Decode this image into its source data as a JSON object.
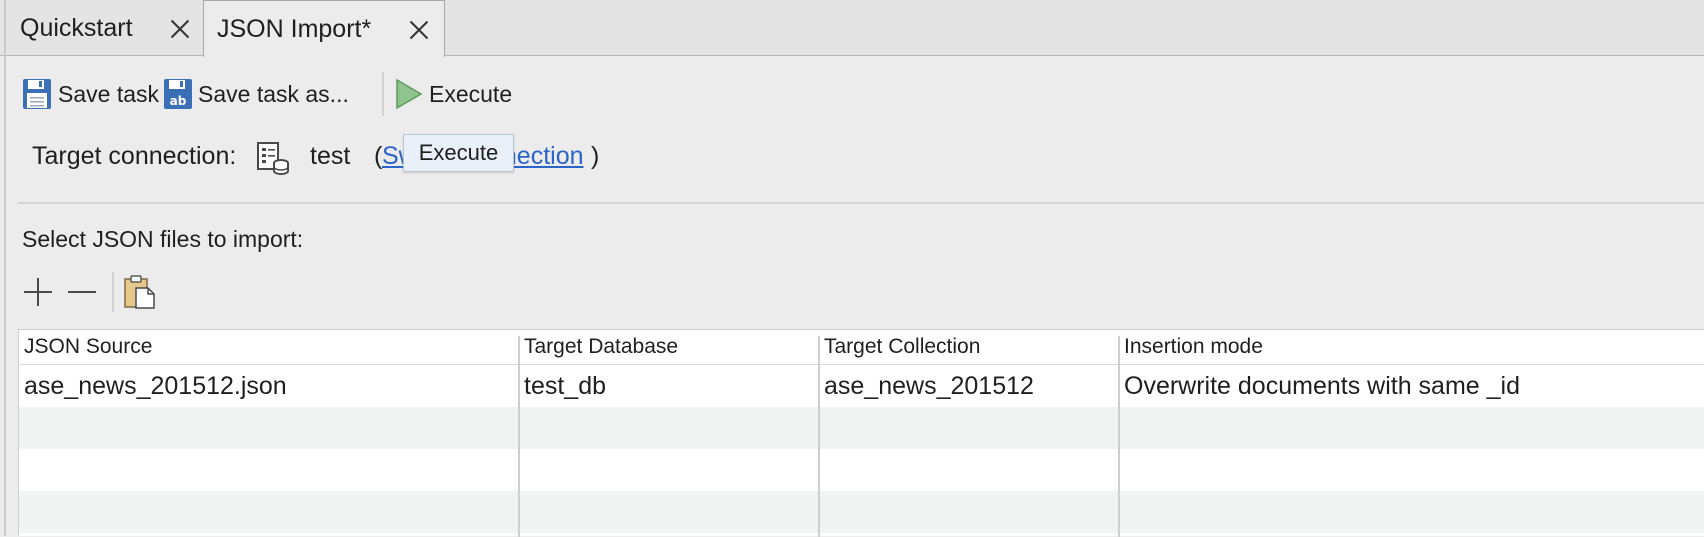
{
  "tabs": [
    {
      "label": "Quickstart"
    },
    {
      "label": "JSON Import*"
    }
  ],
  "toolbar": {
    "save_task": "Save task",
    "save_task_as": "Save task as...",
    "execute": "Execute"
  },
  "tooltip": {
    "text": "Execute"
  },
  "target": {
    "label": "Target connection:",
    "connection_name": "test",
    "open_paren": "(",
    "switch_link": "Switch connection",
    "close_paren": ")"
  },
  "import_section": {
    "label": "Select JSON files to import:"
  },
  "table": {
    "columns": [
      "JSON Source",
      "Target Database",
      "Target Collection",
      "Insertion mode"
    ],
    "rows": [
      {
        "source": "ase_news_201512.json",
        "database": "test_db",
        "collection": "ase_news_201512",
        "mode": "Overwrite documents with same _id"
      }
    ]
  },
  "colors": {
    "link": "#2a64c8",
    "icon_blue": "#3b6fb6",
    "execute_green": "#8fc48f",
    "tooltip_bg": "#e9f0f7"
  },
  "icons": {
    "save_task": "floppy-disk-icon",
    "save_task_as": "floppy-disk-ab-icon",
    "execute": "play-icon",
    "connection": "server-database-icon",
    "add": "plus-icon",
    "remove": "minus-icon",
    "paste": "clipboard-paste-icon"
  }
}
